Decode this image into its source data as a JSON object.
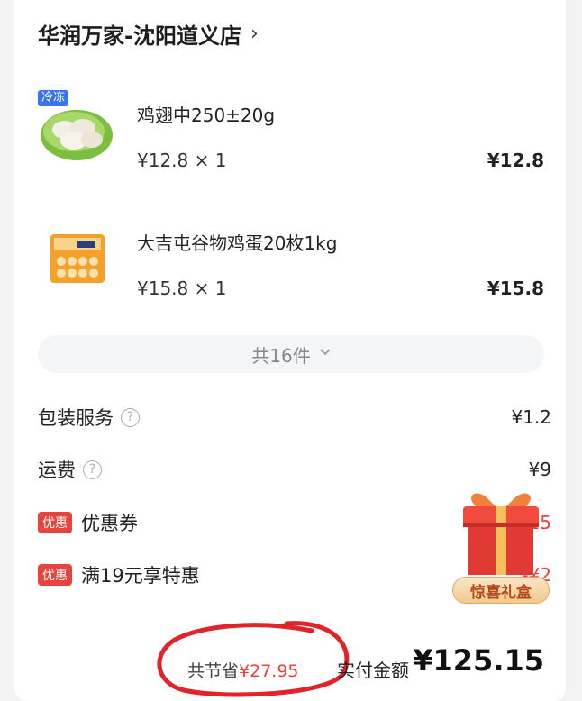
{
  "store": {
    "name": "华润万家-沈阳道义店",
    "chevron": "›"
  },
  "products": [
    {
      "tag": "冷冻",
      "name": "鸡翅中250±20g",
      "unit_price_qty": "¥12.8 × 1",
      "total": "¥12.8"
    },
    {
      "tag": "",
      "name": "大吉屯谷物鸡蛋20枚1kg",
      "unit_price_qty": "¥15.8 × 1",
      "total": "¥15.8"
    }
  ],
  "item_count": "共16件",
  "fees": [
    {
      "label": "包装服务",
      "amount": "¥1.2"
    },
    {
      "label": "运费",
      "amount": "¥9"
    }
  ],
  "discounts": [
    {
      "badge": "优惠",
      "label": "优惠券",
      "amount": "-¥15"
    },
    {
      "badge": "优惠",
      "label": "满19元享特惠",
      "amount": "-¥2"
    }
  ],
  "gift_box": {
    "label": "惊喜礼盒"
  },
  "footer": {
    "saved_prefix": "共节省",
    "saved_amount": "¥27.95",
    "pay_label": "实付金额",
    "pay_amount": "¥125.15"
  },
  "colors": {
    "accent_red": "#e8433d",
    "frozen_blue": "#3a73f0",
    "annotation_ring": "#e0242a"
  }
}
